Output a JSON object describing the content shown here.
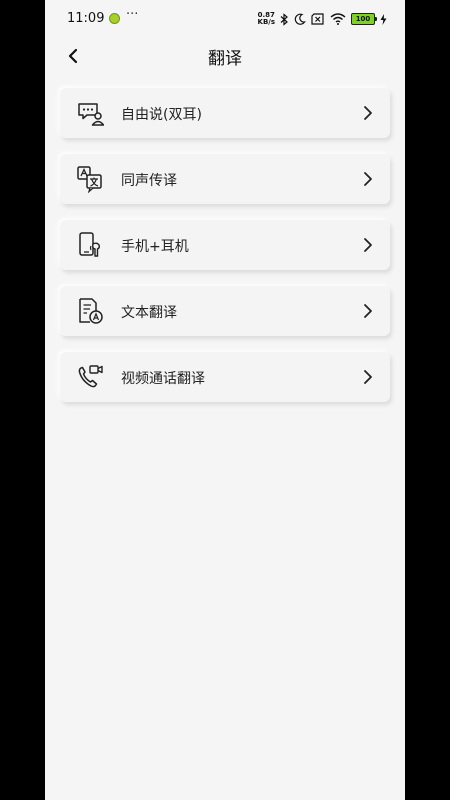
{
  "status_bar": {
    "time": "11:09",
    "more": "···",
    "net_speed_value": "0.87",
    "net_speed_unit": "KB/s",
    "battery": "100",
    "icons": [
      "bluetooth-icon",
      "moon-icon",
      "sim-off-icon",
      "wifi-icon",
      "battery-icon",
      "charging-icon"
    ]
  },
  "header": {
    "title": "翻译",
    "back_icon": "chevron-left-icon"
  },
  "menu": {
    "items": [
      {
        "label": "自由说(双耳)",
        "icon": "chat-person-icon"
      },
      {
        "label": "同声传译",
        "icon": "translate-icon"
      },
      {
        "label": "手机+耳机",
        "icon": "phone-earbud-icon"
      },
      {
        "label": "文本翻译",
        "icon": "document-translate-icon"
      },
      {
        "label": "视频通话翻译",
        "icon": "video-call-icon"
      }
    ]
  },
  "colors": {
    "background": "#f5f5f5",
    "text": "#222222",
    "battery": "#7ed321"
  }
}
